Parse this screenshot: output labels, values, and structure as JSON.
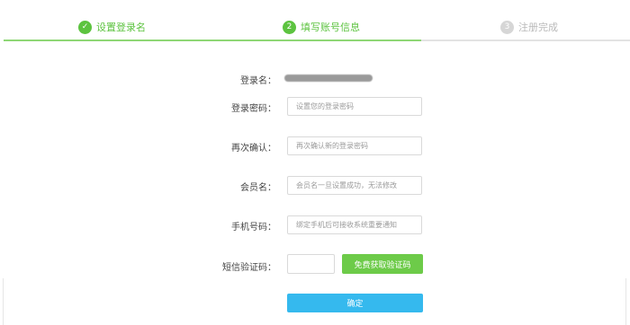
{
  "steps": [
    {
      "label": "设置登录名",
      "marker": "✓",
      "state": "done",
      "icon": "check-icon"
    },
    {
      "label": "填写账号信息",
      "marker": "2",
      "state": "active"
    },
    {
      "label": "注册完成",
      "marker": "3",
      "state": "pending"
    }
  ],
  "colors": {
    "accent": "#5cc33f",
    "primary": "#35b9ee",
    "sms_button": "#6dcb49"
  },
  "form": {
    "login_name": {
      "label": "登录名："
    },
    "password": {
      "label": "登录密码：",
      "placeholder": "设置您的登录密码"
    },
    "confirm": {
      "label": "再次确认：",
      "placeholder": "再次确认新的登录密码"
    },
    "member_name": {
      "label": "会员名：",
      "placeholder": "会员名一旦设置成功，无法修改"
    },
    "phone": {
      "label": "手机号码：",
      "placeholder": "绑定手机后可接收系统重要通知"
    },
    "sms": {
      "label": "短信验证码：",
      "button": "免费获取验证码"
    },
    "submit": "确定"
  }
}
